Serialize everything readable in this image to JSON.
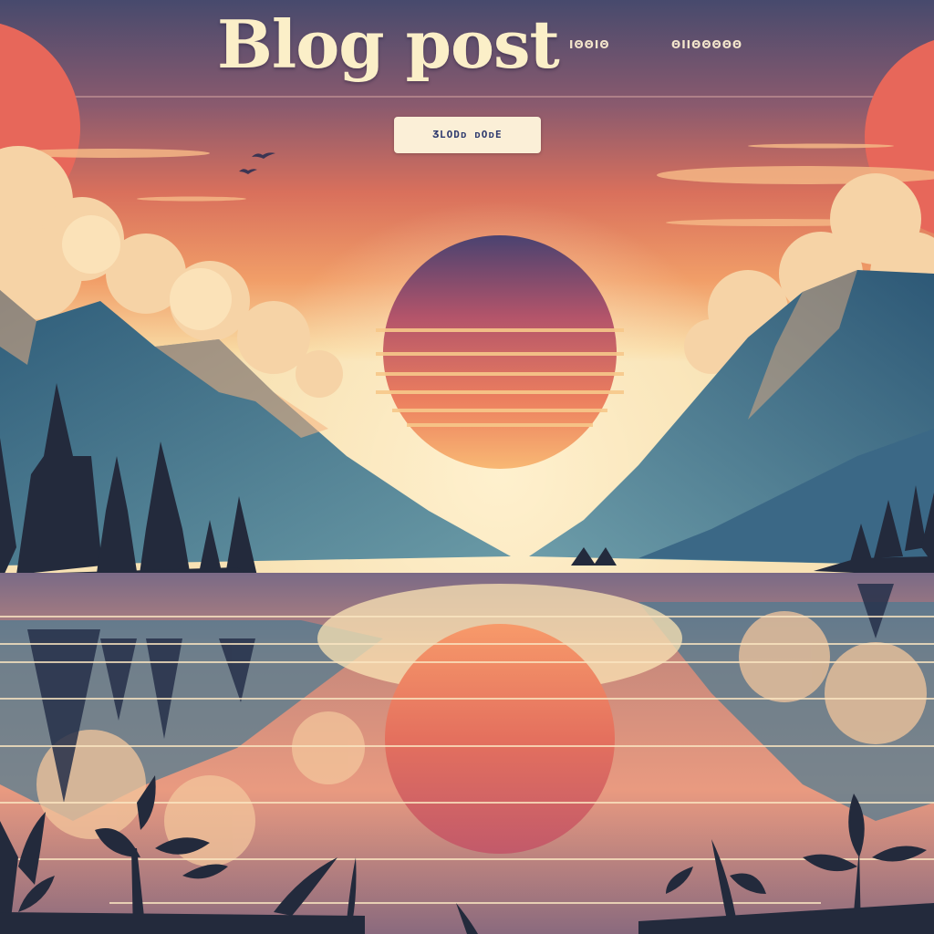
{
  "header": {
    "title": "Blog post",
    "nav": [
      {
        "label": "ΙΘΘΙΘ"
      },
      {
        "label": "ΘΙΙΘΘΘΘΘ"
      }
    ]
  },
  "hero": {
    "cta_label": "ƷLODᴅ ᴅOᴅE"
  },
  "colors": {
    "sky_top": "#4a4a6e",
    "sky_mid": "#e07a5a",
    "sky_glow": "#f6d8a4",
    "mountain": "#3f6e86",
    "silhouette": "#232a3c",
    "sun_top": "#4a4270",
    "sun_bottom": "#f7a76a",
    "cloud": "#f6dcae",
    "title": "#fbefc8",
    "button_bg": "#fbefd7",
    "button_text": "#2e3a6e"
  }
}
